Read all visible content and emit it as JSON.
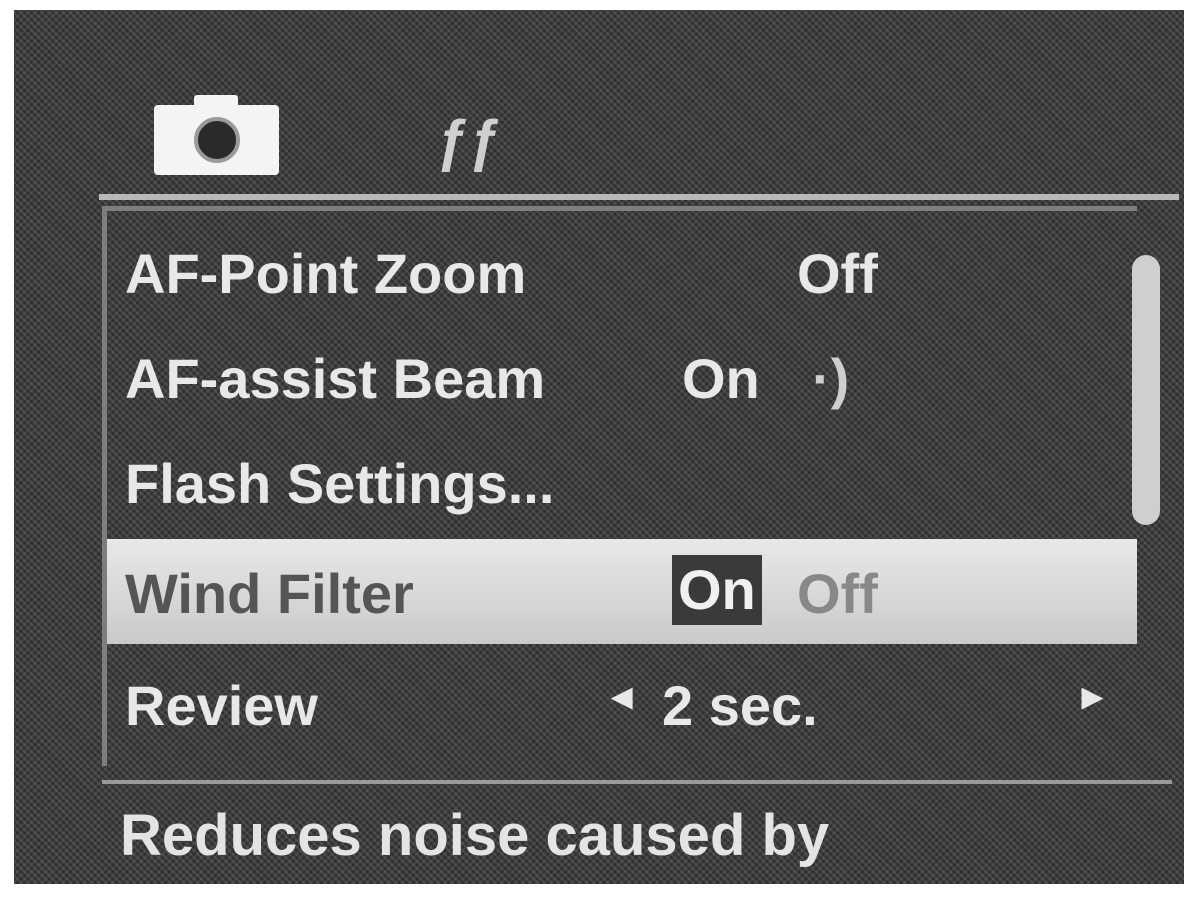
{
  "tabs": {
    "camera_icon": "camera-icon",
    "tools_icon": "tools-icon",
    "tools_glyph": "ƒƒ"
  },
  "menu": {
    "items": [
      {
        "label": "AF-Point Zoom",
        "value": "Off",
        "indicator": ""
      },
      {
        "label": "AF-assist Beam",
        "value": "On",
        "indicator": "·)"
      },
      {
        "label": "Flash Settings...",
        "value": "",
        "indicator": ""
      },
      {
        "label": "Wind Filter",
        "value": "On",
        "indicator": "Off"
      },
      {
        "label": "Review",
        "value": "2 sec.",
        "indicator": "◂",
        "arrow": "▸"
      }
    ],
    "selected_index": 3
  },
  "help": {
    "text": "Reduces noise caused by"
  },
  "colors": {
    "background": "#3d3d3d",
    "highlight": "#dcdcdc",
    "text": "#e8e8e8"
  }
}
